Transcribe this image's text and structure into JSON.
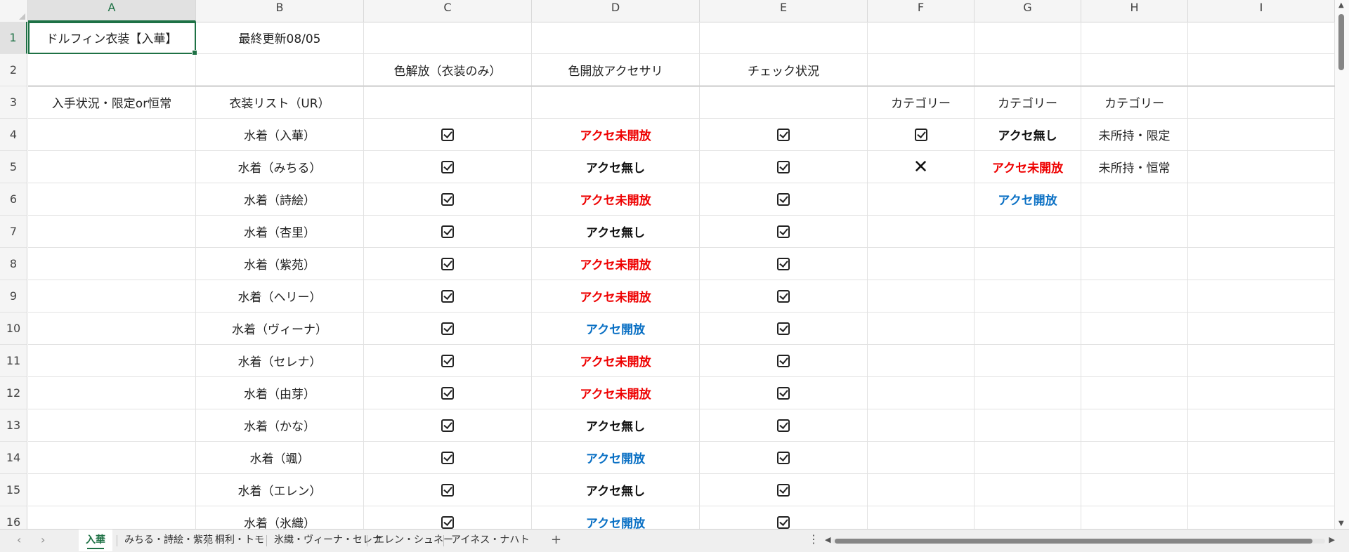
{
  "columns": [
    "A",
    "B",
    "C",
    "D",
    "E",
    "F",
    "G",
    "H",
    "I"
  ],
  "active_column": "A",
  "active_row": "1",
  "rows": [
    {
      "n": "1",
      "cells": [
        {
          "col": "A",
          "text": "ドルフィン衣装【入華】"
        },
        {
          "col": "B",
          "text": "最終更新08/05"
        }
      ]
    },
    {
      "n": "2",
      "cells": [
        {
          "col": "C",
          "text": "色解放（衣装のみ）"
        },
        {
          "col": "D",
          "text": "色開放アクセサリ"
        },
        {
          "col": "E",
          "text": "チェック状況"
        }
      ]
    },
    {
      "n": "3",
      "cells": [
        {
          "col": "A",
          "text": "入手状況・限定or恒常"
        },
        {
          "col": "B",
          "text": "衣装リスト（UR）"
        },
        {
          "col": "F",
          "text": "カテゴリー"
        },
        {
          "col": "G",
          "text": "カテゴリー"
        },
        {
          "col": "H",
          "text": "カテゴリー"
        }
      ]
    },
    {
      "n": "4",
      "cells": [
        {
          "col": "B",
          "text": "水着（入華）"
        },
        {
          "col": "C",
          "check": true
        },
        {
          "col": "D",
          "text": "アクセ未開放",
          "style": "red"
        },
        {
          "col": "E",
          "check": true
        },
        {
          "col": "F",
          "check": true
        },
        {
          "col": "G",
          "text": "アクセ無し",
          "style": "black"
        },
        {
          "col": "H",
          "text": "未所持・限定"
        }
      ]
    },
    {
      "n": "5",
      "cells": [
        {
          "col": "B",
          "text": "水着（みちる）"
        },
        {
          "col": "C",
          "check": true
        },
        {
          "col": "D",
          "text": "アクセ無し",
          "style": "black"
        },
        {
          "col": "E",
          "check": true
        },
        {
          "col": "F",
          "cross": true
        },
        {
          "col": "G",
          "text": "アクセ未開放",
          "style": "red"
        },
        {
          "col": "H",
          "text": "未所持・恒常"
        }
      ]
    },
    {
      "n": "6",
      "cells": [
        {
          "col": "B",
          "text": "水着（詩絵）"
        },
        {
          "col": "C",
          "check": true
        },
        {
          "col": "D",
          "text": "アクセ未開放",
          "style": "red"
        },
        {
          "col": "E",
          "check": true
        },
        {
          "col": "G",
          "text": "アクセ開放",
          "style": "blue"
        }
      ]
    },
    {
      "n": "7",
      "cells": [
        {
          "col": "B",
          "text": "水着（杏里）"
        },
        {
          "col": "C",
          "check": true
        },
        {
          "col": "D",
          "text": "アクセ無し",
          "style": "black"
        },
        {
          "col": "E",
          "check": true
        }
      ]
    },
    {
      "n": "8",
      "cells": [
        {
          "col": "B",
          "text": "水着（紫苑）"
        },
        {
          "col": "C",
          "check": true
        },
        {
          "col": "D",
          "text": "アクセ未開放",
          "style": "red"
        },
        {
          "col": "E",
          "check": true
        }
      ]
    },
    {
      "n": "9",
      "cells": [
        {
          "col": "B",
          "text": "水着（ヘリー）"
        },
        {
          "col": "C",
          "check": true
        },
        {
          "col": "D",
          "text": "アクセ未開放",
          "style": "red"
        },
        {
          "col": "E",
          "check": true
        }
      ]
    },
    {
      "n": "10",
      "cells": [
        {
          "col": "B",
          "text": "水着（ヴィーナ）"
        },
        {
          "col": "C",
          "check": true
        },
        {
          "col": "D",
          "text": "アクセ開放",
          "style": "blue"
        },
        {
          "col": "E",
          "check": true
        }
      ]
    },
    {
      "n": "11",
      "cells": [
        {
          "col": "B",
          "text": "水着（セレナ）"
        },
        {
          "col": "C",
          "check": true
        },
        {
          "col": "D",
          "text": "アクセ未開放",
          "style": "red"
        },
        {
          "col": "E",
          "check": true
        }
      ]
    },
    {
      "n": "12",
      "cells": [
        {
          "col": "B",
          "text": "水着（由芽）"
        },
        {
          "col": "C",
          "check": true
        },
        {
          "col": "D",
          "text": "アクセ未開放",
          "style": "red"
        },
        {
          "col": "E",
          "check": true
        }
      ]
    },
    {
      "n": "13",
      "cells": [
        {
          "col": "B",
          "text": "水着（かな）"
        },
        {
          "col": "C",
          "check": true
        },
        {
          "col": "D",
          "text": "アクセ無し",
          "style": "black"
        },
        {
          "col": "E",
          "check": true
        }
      ]
    },
    {
      "n": "14",
      "cells": [
        {
          "col": "B",
          "text": "水着（颯）"
        },
        {
          "col": "C",
          "check": true
        },
        {
          "col": "D",
          "text": "アクセ開放",
          "style": "blue"
        },
        {
          "col": "E",
          "check": true
        }
      ]
    },
    {
      "n": "15",
      "cells": [
        {
          "col": "B",
          "text": "水着（エレン）"
        },
        {
          "col": "C",
          "check": true
        },
        {
          "col": "D",
          "text": "アクセ無し",
          "style": "black"
        },
        {
          "col": "E",
          "check": true
        }
      ]
    },
    {
      "n": "16",
      "cells": [
        {
          "col": "B",
          "text": "水着（氷織）"
        },
        {
          "col": "C",
          "check": true
        },
        {
          "col": "D",
          "text": "アクセ開放",
          "style": "blue"
        },
        {
          "col": "E",
          "check": true
        }
      ]
    }
  ],
  "sheet_tabs": [
    "入華",
    "みちる・詩絵・紫苑",
    "桐利・トモ",
    "氷織・ヴィーナ・セレナ",
    "エレン・シュネー",
    "アイネス・ナハト"
  ],
  "active_tab": "入華",
  "add_tab_label": "+",
  "more_label": "⋮",
  "icons": {
    "check": "checked-checkbox-icon",
    "cross": "cross-icon",
    "prev_sheet": "chevron-left-icon",
    "next_sheet": "chevron-right-icon"
  },
  "colors": {
    "red": "#ee0000",
    "blue": "#0a70c4",
    "accent": "#1e7145"
  }
}
